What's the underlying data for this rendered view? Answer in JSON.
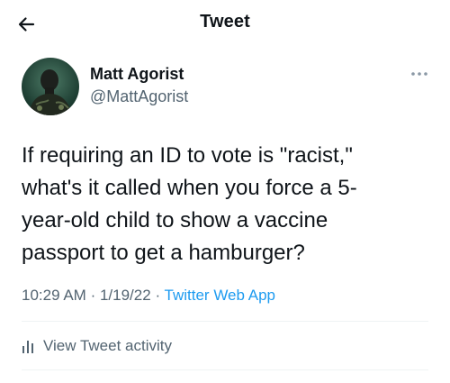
{
  "header": {
    "title": "Tweet",
    "back_icon": "arrow-left-icon"
  },
  "author": {
    "name": "Matt Agorist",
    "handle": "@MattAgorist",
    "more_icon": "more-horizontal-icon"
  },
  "tweet": {
    "text": "If requiring an ID to vote is \"racist,\"\nwhat's it called when you force a 5-\nyear-old child to show a vaccine\npassport to get a hamburger?",
    "time": "10:29 AM",
    "separator": "·",
    "date": "1/19/22",
    "source": "Twitter Web App"
  },
  "activity": {
    "label": "View Tweet activity",
    "icon": "bar-chart-icon"
  },
  "colors": {
    "text": "#0f1419",
    "secondary": "#536471",
    "link": "#1d9bf0",
    "divider": "#eff3f4"
  }
}
